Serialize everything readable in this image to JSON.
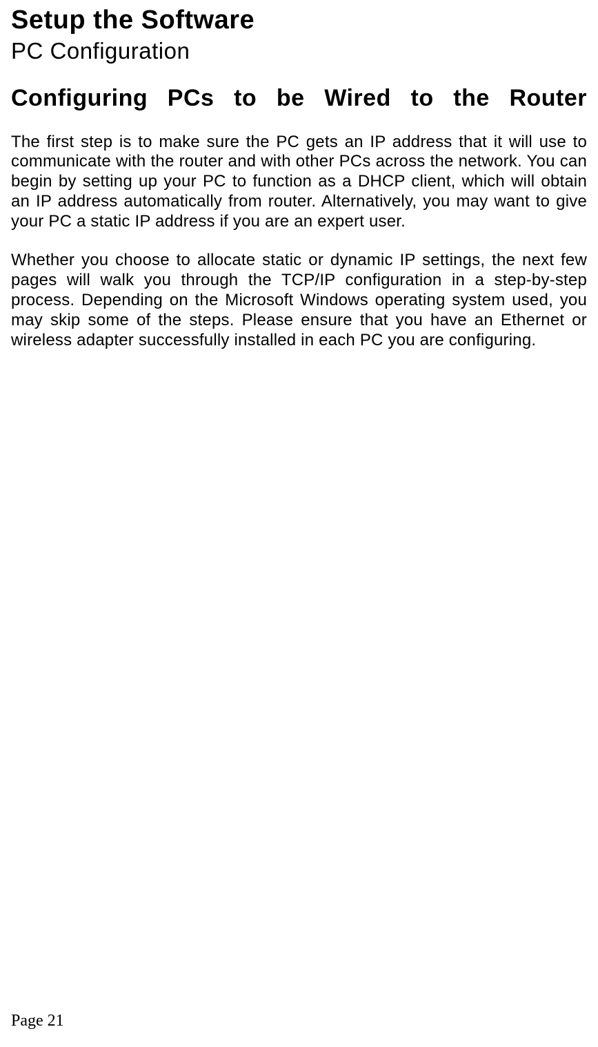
{
  "chapterTitle": "Setup the Software",
  "sectionTitle": "PC Configuration",
  "subTitle": "Configuring PCs to be Wired to the Router",
  "paragraphs": [
    "The first step is to make sure the PC gets an IP address that it will use to communicate with the router and with other PCs across the network. You can begin by setting up your PC to function as a DHCP client, which will obtain an IP address automatically from router. Alternatively, you may want to give your PC a static IP address if you are an expert user.",
    "Whether you choose to allocate static or dynamic IP settings, the next few pages will walk you through the TCP/IP configuration in a step-by-step process. Depending on the Microsoft Windows operating system used, you may skip some of the steps. Please ensure that you have an Ethernet or wireless adapter successfully installed in each PC you are configuring."
  ],
  "pageFooter": "Page 21"
}
